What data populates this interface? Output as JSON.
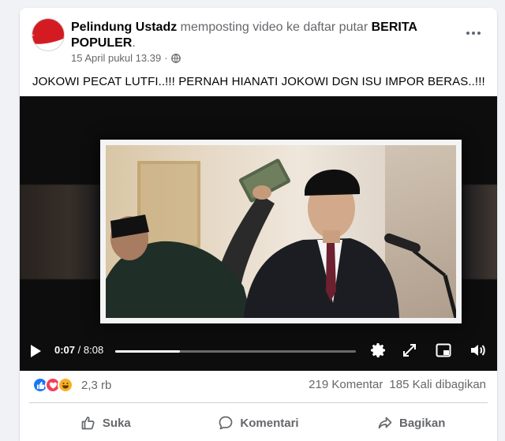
{
  "post": {
    "author": "Pelindung Ustadz",
    "action_text": " memposting video ke daftar putar ",
    "playlist": "BERITA POPULER",
    "period": ".",
    "timestamp": "15 April pukul 13.39",
    "separator": "·",
    "privacy_icon": "globe-icon",
    "caption": "JOKOWI PECAT LUTFI..!!! PERNAH HIANATI JOKOWI DGN ISU IMPOR BERAS..!!!"
  },
  "video": {
    "current_time": "0:07",
    "time_sep": " / ",
    "duration": "8:08",
    "progress": 0.27,
    "icons": [
      "play-icon",
      "settings-gear-icon",
      "fullscreen-expand-icon",
      "picture-in-picture-icon",
      "volume-icon"
    ]
  },
  "engagement": {
    "reactions": [
      "like",
      "love",
      "haha"
    ],
    "reaction_count": "2,3 rb",
    "comments": "219 Komentar",
    "shares": "185 Kali dibagikan"
  },
  "actions": {
    "like": "Suka",
    "comment": "Komentari",
    "share": "Bagikan"
  },
  "colors": {
    "accent": "#1877f2",
    "love": "#f33e58",
    "haha": "#f7b125",
    "secondary_text": "#65676b"
  }
}
